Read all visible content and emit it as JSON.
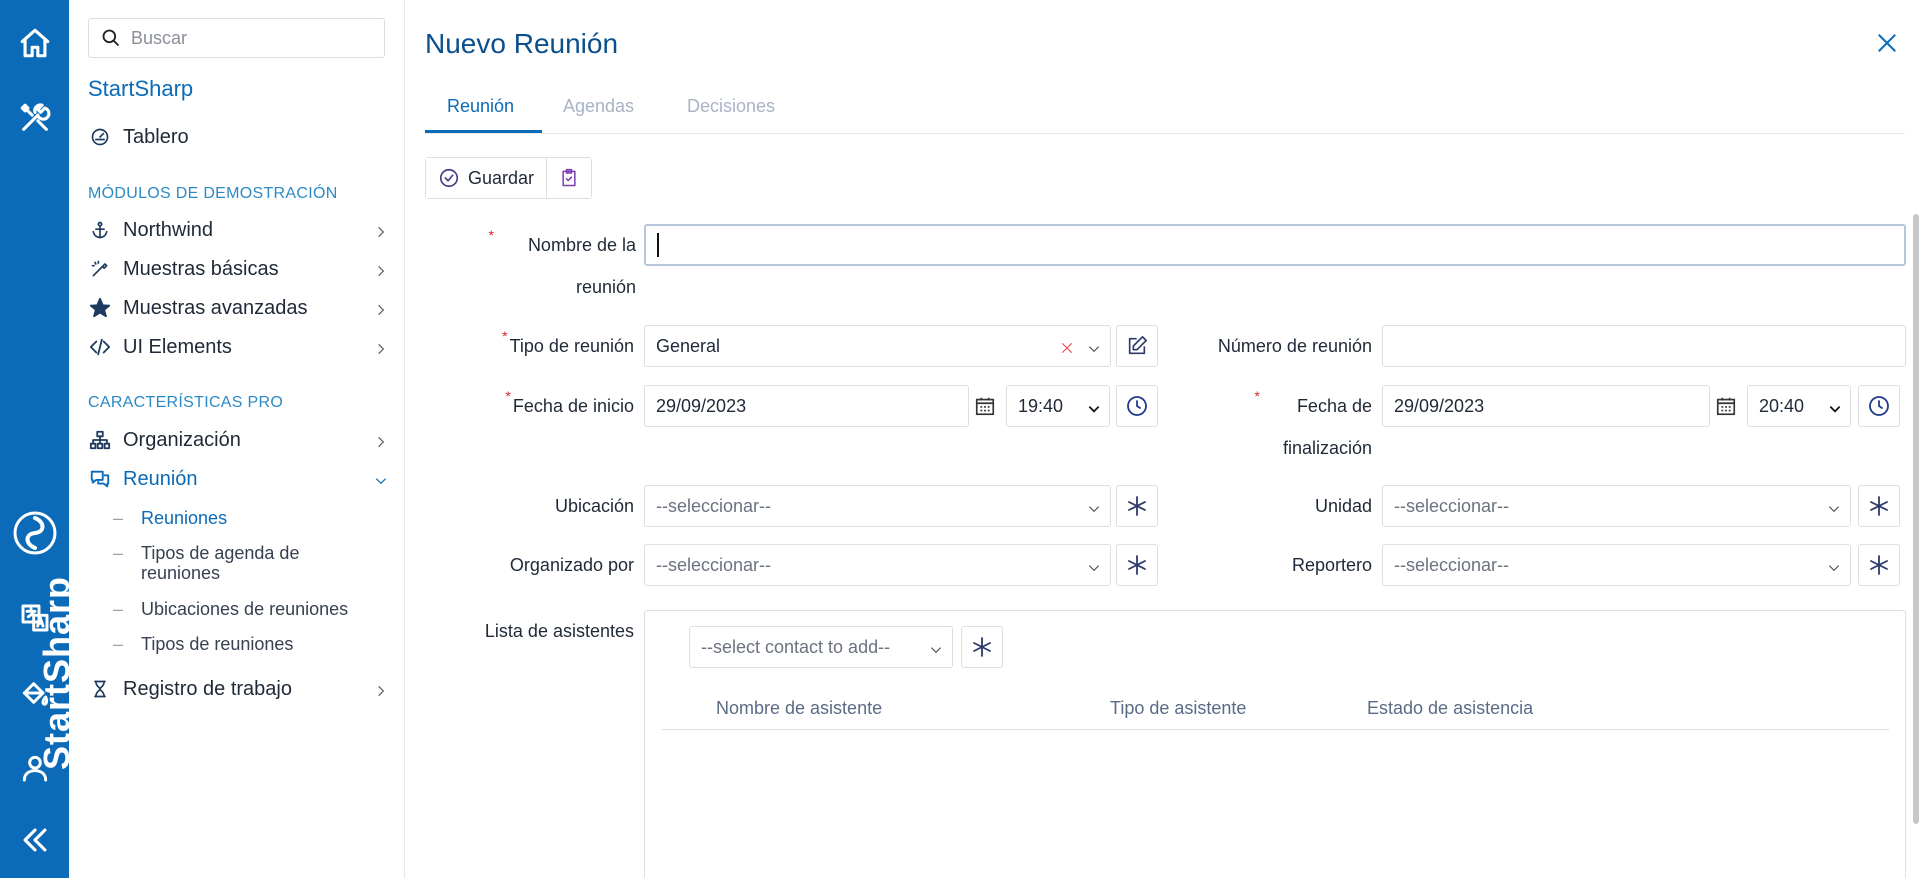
{
  "sidebar": {
    "search_placeholder": "Buscar",
    "brand": "StartSharp",
    "items": [
      {
        "label": "Tablero",
        "icon": "dashboard-gauge-icon"
      },
      {
        "label": "Northwind",
        "icon": "anchor-icon"
      },
      {
        "label": "Muestras básicas",
        "icon": "wand-icon"
      },
      {
        "label": "Muestras avanzadas",
        "icon": "star-icon"
      },
      {
        "label": "UI Elements",
        "icon": "code-icon"
      },
      {
        "label": "Organización",
        "icon": "org-chart-icon"
      },
      {
        "label": "Reunión",
        "icon": "chat-icon"
      },
      {
        "label": "Registro de trabajo",
        "icon": "hourglass-icon"
      }
    ],
    "sections": {
      "demo": "MÓDULOS DE DEMOSTRACIÓN",
      "pro": "CARACTERÍSTICAS PRO"
    },
    "sub_items": [
      "Reuniones",
      "Tipos de agenda de reuniones",
      "Ubicaciones de reuniones",
      "Tipos de reuniones"
    ]
  },
  "rail": {
    "brand_text": "StartSharp"
  },
  "dialog": {
    "title": "Nuevo Reunión",
    "tabs": [
      "Reunión",
      "Agendas",
      "Decisiones"
    ],
    "toolbar": {
      "save_label": "Guardar"
    },
    "fields": {
      "name_label": "Nombre de la reunión",
      "name_value": "",
      "type_label": "Tipo de reunión",
      "type_value": "General",
      "number_label": "Número de reunión",
      "number_value": "",
      "start_label": "Fecha de inicio",
      "start_date": "29/09/2023",
      "start_time": "19:40",
      "end_label": "Fecha de finalización",
      "end_date": "29/09/2023",
      "end_time": "20:40",
      "location_label": "Ubicación",
      "location_value": "--seleccionar--",
      "unit_label": "Unidad",
      "unit_value": "--seleccionar--",
      "organizer_label": "Organizado por",
      "organizer_value": "--seleccionar--",
      "reporter_label": "Reportero",
      "reporter_value": "--seleccionar--",
      "attendees_label": "Lista de asistentes",
      "contact_placeholder": "--select contact to add--"
    },
    "attendee_columns": [
      "Nombre de asistente",
      "Tipo de asistente",
      "Estado de asistencia"
    ]
  },
  "colors": {
    "rail_bg": "#0b6bb8",
    "accent": "#0b6bb8",
    "required": "#d22222"
  }
}
